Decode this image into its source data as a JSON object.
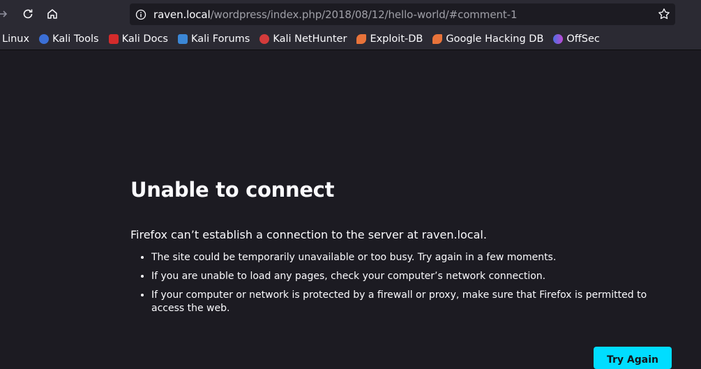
{
  "browser": {
    "url": {
      "host": "raven.local",
      "path": "/wordpress/index.php/2018/08/12/hello-world/#comment-1"
    },
    "bookmarks": [
      {
        "label": "Linux",
        "icon": "none",
        "color": ""
      },
      {
        "label": "Kali Tools",
        "icon": "kali-tools-icon",
        "color": "#3b6fd6"
      },
      {
        "label": "Kali Docs",
        "icon": "kali-docs-icon",
        "color": "#d42b2b"
      },
      {
        "label": "Kali Forums",
        "icon": "kali-forums-icon",
        "color": "#3b87d6"
      },
      {
        "label": "Kali NetHunter",
        "icon": "nethunter-icon",
        "color": "#d43b3b"
      },
      {
        "label": "Exploit-DB",
        "icon": "exploit-db-icon",
        "color": "#e8733a"
      },
      {
        "label": "Google Hacking DB",
        "icon": "ghdb-icon",
        "color": "#e8733a"
      },
      {
        "label": "OffSec",
        "icon": "offsec-icon",
        "color": "#4a6fe0"
      }
    ]
  },
  "error": {
    "title": "Unable to connect",
    "lead": "Firefox can’t establish a connection to the server at raven.local.",
    "reasons": [
      "The site could be temporarily unavailable or too busy. Try again in a few moments.",
      "If you are unable to load any pages, check your computer’s network connection.",
      "If your computer or network is protected by a firewall or proxy, make sure that Firefox is permitted to access the web."
    ],
    "button": "Try Again"
  },
  "colors": {
    "background": "#1c1b22",
    "toolbar": "#2b2a33",
    "accent_button": "#00ddff"
  }
}
